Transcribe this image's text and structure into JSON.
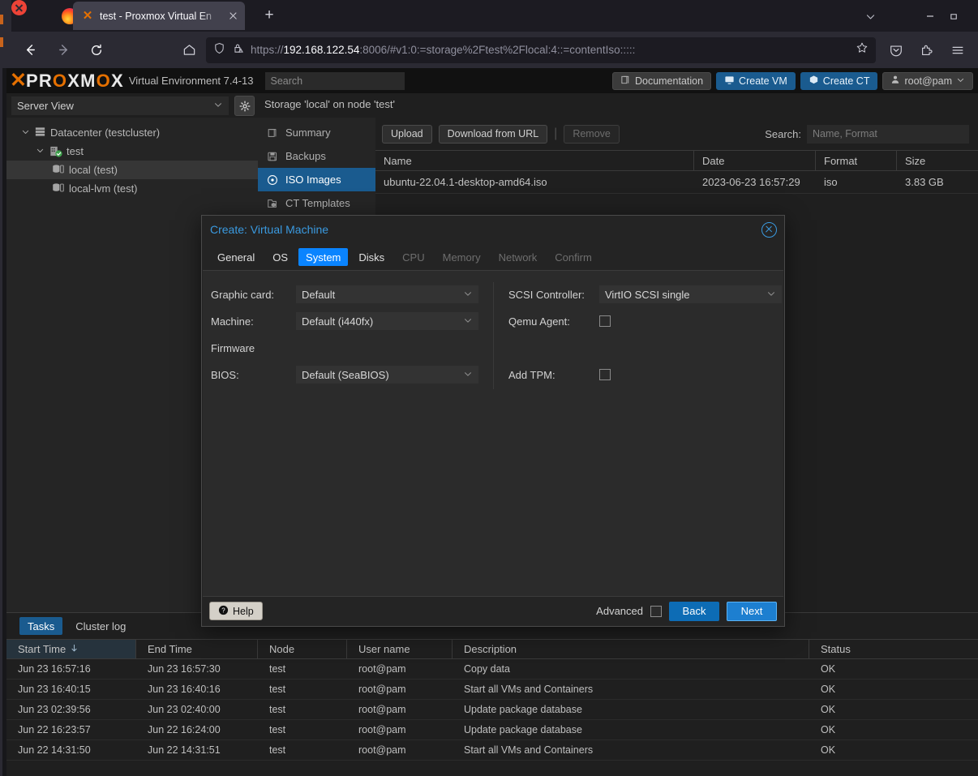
{
  "browser": {
    "tab": {
      "title": "test - Proxmox Virtual En",
      "favicon": "proxmox-x-icon",
      "close_icon": "close-icon"
    },
    "new_tab_label": "+",
    "url": {
      "scheme": "https://",
      "host": "192.168.122.54",
      "rest": ":8006/#v1:0:=storage%2Ftest%2Flocal:4::=contentIso:::::"
    },
    "url_full": "https://192.168.122.54:8006/#v1:0:=storage%2Ftest%2Flocal:4::=contentIso:::::",
    "nav": {
      "back": "back-arrow-icon",
      "forward": "forward-arrow-icon",
      "reload": "reload-icon",
      "home": "home-icon"
    },
    "urlbar_icons": {
      "shield": "shield-icon",
      "lock": "lock-warning-icon",
      "bookmark": "star-icon"
    },
    "toolbar_right": {
      "pocket": "pocket-icon",
      "extensions": "extensions-icon",
      "menu": "hamburger-menu-icon"
    },
    "window_controls": {
      "tablist": "chevron-down-icon",
      "minimize": "minimize-icon",
      "maximize": "maximize-icon",
      "close": "window-close-icon"
    }
  },
  "pve": {
    "logo": {
      "mark": "X",
      "word_pre": "PR",
      "word_o": "O",
      "word_post": "XM",
      "word_o2": "O",
      "word_end": "X",
      "full": "PROXMOX"
    },
    "version": "Virtual Environment 7.4-13",
    "search_placeholder": "Search",
    "header_buttons": [
      {
        "label": "Documentation",
        "icon": "book-icon",
        "style": "grey"
      },
      {
        "label": "Create VM",
        "icon": "monitor-icon",
        "style": "blue"
      },
      {
        "label": "Create CT",
        "icon": "box-icon",
        "style": "blue"
      },
      {
        "label": "root@pam",
        "icon": "user-icon",
        "style": "user"
      }
    ],
    "view_selector": {
      "value": "Server View",
      "chevron": "chevron-down-icon"
    },
    "gear_icon": "gear-icon",
    "breadcrumb": "Storage 'local' on node 'test'",
    "help_button": {
      "label": "Help",
      "icon": "help-icon"
    },
    "tree": [
      {
        "label": "Datacenter (testcluster)",
        "icon": "datacenter-icon",
        "expander": "chevron-down-icon",
        "indent": 18,
        "selected": false
      },
      {
        "label": "test",
        "icon": "node-icon",
        "expander": "chevron-down-icon",
        "indent": 36,
        "selected": false
      },
      {
        "label": "local (test)",
        "icon": "storage-icon",
        "expander": "",
        "indent": 56,
        "selected": true
      },
      {
        "label": "local-lvm (test)",
        "icon": "storage-icon",
        "expander": "",
        "indent": 56,
        "selected": false
      }
    ],
    "content_menu": [
      {
        "label": "Summary",
        "icon": "summary-icon",
        "active": false
      },
      {
        "label": "Backups",
        "icon": "backup-icon",
        "active": false
      },
      {
        "label": "ISO Images",
        "icon": "disc-icon",
        "active": true
      },
      {
        "label": "CT Templates",
        "icon": "template-icon",
        "active": false
      }
    ],
    "toolbar": {
      "upload": "Upload",
      "download_from_url": "Download from URL",
      "remove": "Remove",
      "separator": "|",
      "search_label": "Search:",
      "search_placeholder": "Name, Format"
    },
    "iso_grid": {
      "columns": [
        "Name",
        "Date",
        "Format",
        "Size"
      ],
      "rows": [
        {
          "name": "ubuntu-22.04.1-desktop-amd64.iso",
          "date": "2023-06-23 16:57:29",
          "format": "iso",
          "size": "3.83 GB"
        }
      ]
    }
  },
  "modal": {
    "title": "Create: Virtual Machine",
    "close_icon": "close-circle-icon",
    "tabs": [
      {
        "label": "General",
        "state": "enabled"
      },
      {
        "label": "OS",
        "state": "enabled"
      },
      {
        "label": "System",
        "state": "active"
      },
      {
        "label": "Disks",
        "state": "enabled"
      },
      {
        "label": "CPU",
        "state": "disabled"
      },
      {
        "label": "Memory",
        "state": "disabled"
      },
      {
        "label": "Network",
        "state": "disabled"
      },
      {
        "label": "Confirm",
        "state": "disabled"
      }
    ],
    "fields": {
      "graphic_card": {
        "label": "Graphic card:",
        "value": "Default"
      },
      "machine": {
        "label": "Machine:",
        "value": "Default (i440fx)"
      },
      "firmware_heading": "Firmware",
      "bios": {
        "label": "BIOS:",
        "value": "Default (SeaBIOS)"
      },
      "scsi_controller": {
        "label": "SCSI Controller:",
        "value": "VirtIO SCSI single"
      },
      "qemu_agent": {
        "label": "Qemu Agent:",
        "checked": false
      },
      "add_tpm": {
        "label": "Add TPM:",
        "checked": false
      }
    },
    "footer": {
      "help": "Help",
      "help_icon": "help-icon",
      "advanced_label": "Advanced",
      "advanced_checked": false,
      "back": "Back",
      "next": "Next"
    }
  },
  "tasks": {
    "tabs": [
      {
        "label": "Tasks",
        "active": true
      },
      {
        "label": "Cluster log",
        "active": false
      }
    ],
    "columns": [
      "Start Time",
      "End Time",
      "Node",
      "User name",
      "Description",
      "Status"
    ],
    "sort_column": "Start Time",
    "sort_icon": "arrow-down-icon",
    "rows": [
      {
        "start": "Jun 23 16:57:16",
        "end": "Jun 23 16:57:30",
        "node": "test",
        "user": "root@pam",
        "description": "Copy data",
        "status": "OK"
      },
      {
        "start": "Jun 23 16:40:15",
        "end": "Jun 23 16:40:16",
        "node": "test",
        "user": "root@pam",
        "description": "Start all VMs and Containers",
        "status": "OK"
      },
      {
        "start": "Jun 23 02:39:56",
        "end": "Jun 23 02:40:00",
        "node": "test",
        "user": "root@pam",
        "description": "Update package database",
        "status": "OK"
      },
      {
        "start": "Jun 22 16:23:57",
        "end": "Jun 22 16:24:00",
        "node": "test",
        "user": "root@pam",
        "description": "Update package database",
        "status": "OK"
      },
      {
        "start": "Jun 22 14:31:50",
        "end": "Jun 22 14:31:51",
        "node": "test",
        "user": "root@pam",
        "description": "Start all VMs and Containers",
        "status": "OK"
      }
    ]
  },
  "colors": {
    "accent_blue": "#0a84ff",
    "pve_blue": "#1a5b8f",
    "pve_orange": "#e57000",
    "link_blue": "#3a9ae0"
  }
}
